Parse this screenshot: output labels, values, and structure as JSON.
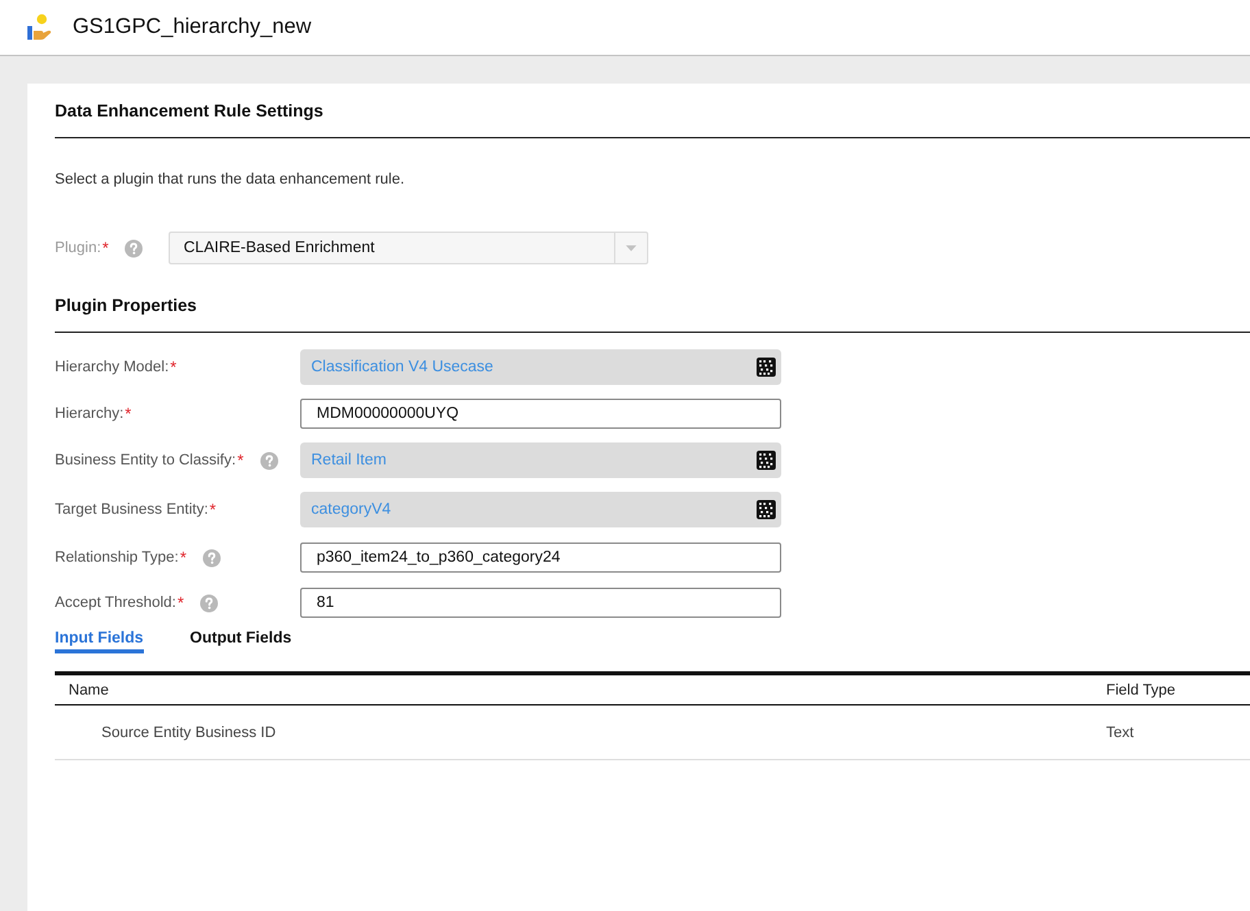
{
  "header": {
    "title": "GS1GPC_hierarchy_new"
  },
  "settings": {
    "title": "Data Enhancement Rule Settings",
    "description": "Select a plugin that runs the data enhancement rule.",
    "plugin": {
      "label": "Plugin:",
      "required_mark": "*",
      "help": true,
      "disabled": true,
      "value": "CLAIRE-Based Enrichment"
    }
  },
  "plugin_properties": {
    "title": "Plugin Properties",
    "fields": [
      {
        "label": "Hierarchy Model:",
        "required_mark": "*",
        "help": false,
        "kind": "lookup",
        "value": "Classification V4 Usecase"
      },
      {
        "label": "Hierarchy:",
        "required_mark": "*",
        "help": false,
        "kind": "text",
        "value": "MDM00000000UYQ"
      },
      {
        "label": "Business Entity to Classify:",
        "required_mark": "*",
        "help": true,
        "kind": "lookup",
        "value": "Retail Item"
      },
      {
        "label": "Target Business Entity:",
        "required_mark": "*",
        "help": false,
        "kind": "lookup",
        "value": "categoryV4"
      },
      {
        "label": "Relationship Type:",
        "required_mark": "*",
        "help": true,
        "kind": "text",
        "value": "p360_item24_to_p360_category24"
      },
      {
        "label": "Accept Threshold:",
        "required_mark": "*",
        "help": true,
        "kind": "text",
        "value": "81"
      }
    ]
  },
  "tabs": [
    {
      "label": "Input Fields",
      "selected": true
    },
    {
      "label": "Output Fields",
      "selected": false
    }
  ],
  "table": {
    "columns": [
      "Name",
      "Field Type"
    ],
    "rows": [
      [
        "Source Entity Business ID",
        "Text"
      ]
    ]
  }
}
